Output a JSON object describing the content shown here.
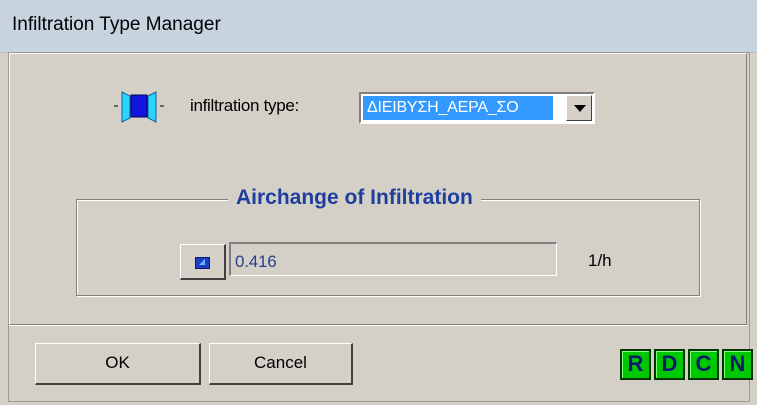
{
  "window": {
    "title": "Infiltration Type Manager"
  },
  "infiltration": {
    "label": "infiltration type:",
    "selected_type": "ΔΙΕΙΒΥΣΗ_ΑΕΡΑ_ΣΟ"
  },
  "airchange": {
    "group_title": "Airchange of Infiltration",
    "value": "0.416",
    "unit": "1/h"
  },
  "buttons": {
    "ok": "OK",
    "cancel": "Cancel",
    "r": "R",
    "d": "D",
    "c": "C",
    "n": "N"
  },
  "colors": {
    "selection": "#3399ff",
    "group_title": "#1f3f9f",
    "rdcn_button": "#00c800"
  }
}
